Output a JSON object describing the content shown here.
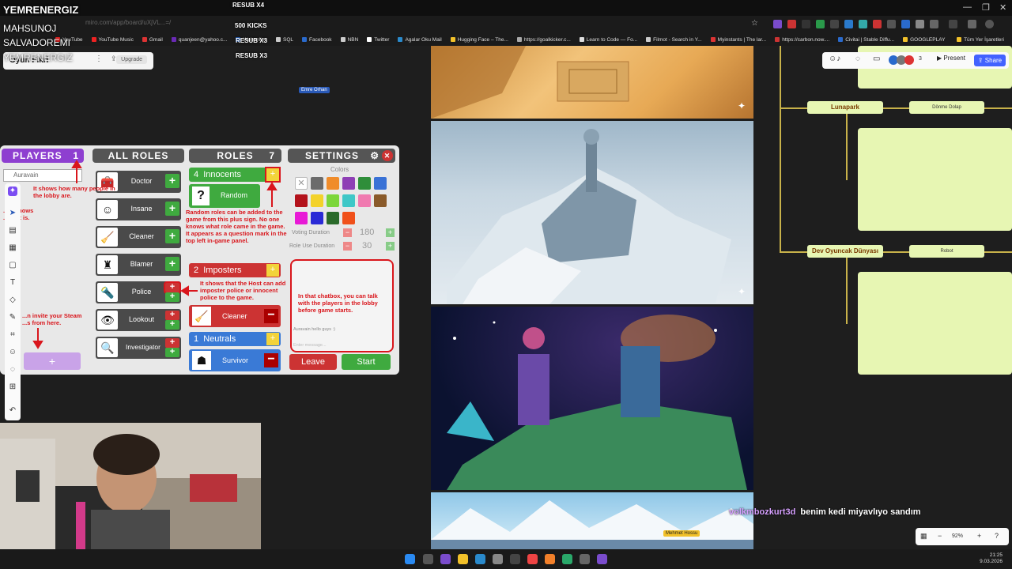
{
  "overlay": {
    "channel": "YEMRENERGIZ",
    "user1": "MAHSUNOJ",
    "user2": "SALVADOREMI",
    "user3": "YEMRENERGIZ",
    "resub1": "RESUB X4",
    "kicks": "500 KICKS",
    "resub2": "RESUB X3",
    "resub3": "RESUB X3"
  },
  "browser": {
    "url": "miro.com/app/board/uXjVL...=/",
    "bookmarks": [
      "YouTube",
      "YouTube Music",
      "Gmail",
      "quanjeen@yahoo.c...",
      "Webonline",
      "SQL",
      "Facebook",
      "NBN",
      "Twitter",
      "Agalar Oku Mail",
      "Hugging Face – The...",
      "https://goalkicker.c...",
      "Learn to Code — Fo...",
      "Filmot - Search in Y...",
      "Myinstants | The lar...",
      "https://carbon.now....",
      "Civitai | Stable Diffu...",
      "GOOGLEPLAY",
      "Tüm Yer İşaretleri"
    ]
  },
  "board": {
    "title": "Oyun Fikri",
    "upgrade_label": "Upgrade",
    "cursor_name": "Emre Orhan",
    "cursor_name2": "Mehmet Hossu",
    "present_label": "Present",
    "share_label": "Share",
    "collaborators_count": "3",
    "zoom": "92%"
  },
  "game": {
    "players_header": "PLAYERS",
    "players_count": "1",
    "player_name": "Auravain",
    "all_roles_header": "ALL ROLES",
    "roles_header": "ROLES",
    "roles_count": "7",
    "settings_header": "SETTINGS",
    "roles": [
      {
        "name": "Doctor",
        "icon": "🧰"
      },
      {
        "name": "Insane",
        "icon": "☺"
      },
      {
        "name": "Cleaner",
        "icon": "🧹"
      },
      {
        "name": "Blamer",
        "icon": "♜"
      },
      {
        "name": "Police",
        "icon": "🔦"
      },
      {
        "name": "Lookout",
        "icon": "👁"
      },
      {
        "name": "Investigator",
        "icon": "🔍"
      }
    ],
    "innocents_count": "4",
    "innocents_label": "Innocents",
    "random_label": "Random",
    "imposters_count": "2",
    "imposters_label": "Imposters",
    "imposter_role": "Cleaner",
    "neutrals_count": "1",
    "neutrals_label": "Neutrals",
    "neutral_role": "Survivor",
    "colors_label": "Colors",
    "voting_label": "Voting Duration",
    "voting_value": "180",
    "role_use_label": "Role Use Duration",
    "role_use_value": "30",
    "chat_message_user": "Auravain",
    "chat_message_text": "hello guys :)",
    "chat_placeholder": "Enter message...",
    "leave_label": "Leave",
    "start_label": "Start",
    "swatch_colors": [
      "#ffffff",
      "#6b6b6b",
      "#f08c2a",
      "#8e3fb5",
      "#2f8e3a",
      "#3a72d6",
      "#b3121b",
      "#f3d22a",
      "#7cd63a",
      "#3fc7c7",
      "#f07ab0",
      "#8a5a2a",
      "#e81ad6",
      "#2a2ad6",
      "#2a6a2a",
      "#f0501a"
    ]
  },
  "annotations": {
    "players_note": "It shows how many people in the lobby are.",
    "host_note": "...m shows ...Host is.",
    "invite_note": "...n invite your Steam ...s from here.",
    "random_note": "Random roles can be added to the game from this plus sign. No one knows what role came in the game. It appears as a question mark in the top left in-game panel.",
    "host_add_note": "It shows that the Host can add imposter police or innocent police to the game.",
    "chatbox_note": "In that chatbox, you can talk with the players in the lobby before game starts."
  },
  "flow": {
    "node1": "Lunapark",
    "node1_child": "Dönme Dolap",
    "node2": "Dev Oyuncak Dünyası",
    "node2_child": "Robot"
  },
  "chat": {
    "user": "volkmbozkurt3d",
    "message": "benim kedi miyavlıyo sandım"
  },
  "taskbar": {
    "time": "21:25",
    "date": "9.03.2026"
  }
}
